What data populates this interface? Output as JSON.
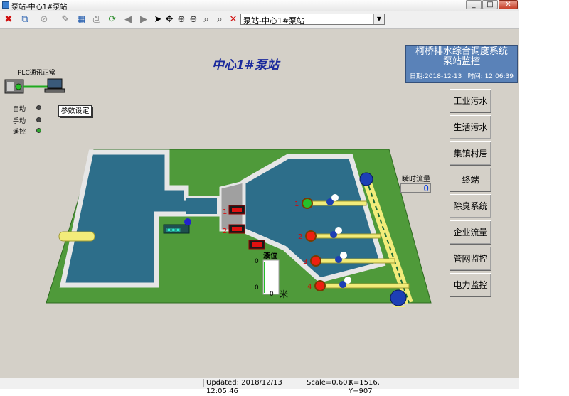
{
  "window": {
    "title": "泵站-中心1#泵站",
    "controls": [
      "minimize",
      "maximize",
      "close"
    ]
  },
  "toolbar": {
    "icons": [
      "delete-icon",
      "new-window-icon",
      "attach-icon",
      "edit-icon",
      "table-icon",
      "print-icon",
      "refresh-icon",
      "back-icon",
      "forward-icon",
      "pointer-icon",
      "pan-icon",
      "zoom-in-icon",
      "zoom-out-icon",
      "zoom-window-icon",
      "zoom-prev-icon",
      "close-red-icon"
    ],
    "station_select": "泵站-中心1#泵站"
  },
  "canvas": {
    "station_title": "中心1#泵站",
    "system": {
      "name": "柯桥排水综合调度系统",
      "sub": "泵站监控",
      "date_label": "日期:",
      "date": "2018-12-13",
      "time_label": "时间:",
      "time": "12:06:39"
    },
    "plc_status": "PLC通讯正常",
    "modes": [
      {
        "label": "自动",
        "state": "off"
      },
      {
        "label": "手动",
        "state": "off"
      },
      {
        "label": "遥控",
        "state": "on"
      }
    ],
    "param_button": "参数设定",
    "flow": {
      "label": "瞬时流量",
      "value": "0"
    },
    "level": {
      "title": "液位",
      "top_value": "0",
      "bottom_value": "0",
      "axis_zero": "0",
      "unit": "米",
      "fill": 0
    },
    "gate_numbers": [
      "1",
      "2"
    ],
    "pumps": [
      {
        "number": "1",
        "color": "#25c02a"
      },
      {
        "number": "2",
        "color": "#ee1f10"
      },
      {
        "number": "3",
        "color": "#ee1f10"
      },
      {
        "number": "4",
        "color": "#ee1f10"
      }
    ],
    "nav": [
      "工业污水",
      "生活污水",
      "集镇村居",
      "终端",
      "除臭系统",
      "企业流量",
      "管网监控",
      "电力监控"
    ]
  },
  "colors": {
    "background": "#d4d0c8",
    "title_blue": "#1b2a9c",
    "system_panel": "#5a82b8",
    "grass": "#4f9a3a",
    "water": "#2d6e8a",
    "wall": "#d9d9d9",
    "pipe": "#f2ec7a",
    "pump_on": "#25c02a",
    "pump_off": "#ee1f10",
    "flow_value": "#0b3fe0"
  },
  "statusbar": {
    "updated": "Updated: 2018/12/13 12:05:46",
    "scale": "Scale=0.601",
    "coords": "X=1516, Y=907"
  }
}
